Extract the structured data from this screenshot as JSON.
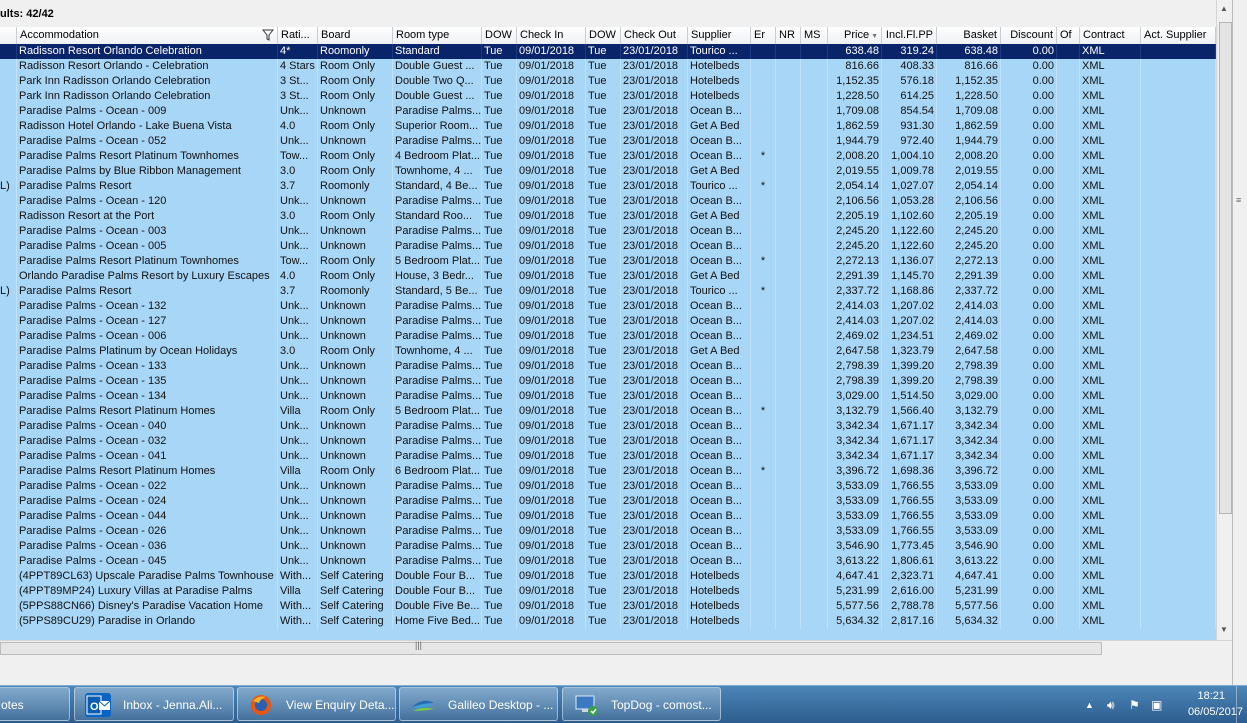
{
  "results": {
    "label": "ults: 42/42"
  },
  "columns": [
    {
      "label": "Accommodation",
      "align": "l"
    },
    {
      "label": "Rati...",
      "align": "l"
    },
    {
      "label": "Board",
      "align": "l"
    },
    {
      "label": "Room type",
      "align": "l"
    },
    {
      "label": "DOW",
      "align": "l"
    },
    {
      "label": "Check In",
      "align": "l"
    },
    {
      "label": "DOW",
      "align": "l"
    },
    {
      "label": "Check Out",
      "align": "l"
    },
    {
      "label": "Supplier",
      "align": "l"
    },
    {
      "label": "Er",
      "align": "l"
    },
    {
      "label": "NR",
      "align": "l"
    },
    {
      "label": "MS",
      "align": "l"
    },
    {
      "label": "Price",
      "align": "r"
    },
    {
      "label": "Incl.Fl.PP",
      "align": "r"
    },
    {
      "label": "Basket",
      "align": "r"
    },
    {
      "label": "Discount",
      "align": "r"
    },
    {
      "label": "Of",
      "align": "l"
    },
    {
      "label": "Contract",
      "align": "l"
    },
    {
      "label": "Act. Supplier",
      "align": "l"
    }
  ],
  "rows": [
    {
      "pre": "",
      "acc": "Radisson Resort Orlando Celebration",
      "rat": "4*",
      "board": "Roomonly",
      "room": "Standard",
      "dow1": "Tue",
      "in": "09/01/2018",
      "dow2": "Tue",
      "out": "23/01/2018",
      "sup": "Tourico ...",
      "er": "",
      "price": "638.48",
      "fl": "319.24",
      "bask": "638.48",
      "disc": "0.00",
      "con": "XML"
    },
    {
      "pre": "",
      "acc": "Radisson Resort Orlando - Celebration",
      "rat": "4 Stars",
      "board": "Room Only",
      "room": "Double Guest ...",
      "dow1": "Tue",
      "in": "09/01/2018",
      "dow2": "Tue",
      "out": "23/01/2018",
      "sup": "Hotelbeds",
      "er": "",
      "price": "816.66",
      "fl": "408.33",
      "bask": "816.66",
      "disc": "0.00",
      "con": "XML"
    },
    {
      "pre": "",
      "acc": "Park Inn Radisson Orlando Celebration",
      "rat": "3 St...",
      "board": "Room Only",
      "room": "Double Two Q...",
      "dow1": "Tue",
      "in": "09/01/2018",
      "dow2": "Tue",
      "out": "23/01/2018",
      "sup": "Hotelbeds",
      "er": "",
      "price": "1,152.35",
      "fl": "576.18",
      "bask": "1,152.35",
      "disc": "0.00",
      "con": "XML"
    },
    {
      "pre": "",
      "acc": "Park Inn Radisson Orlando Celebration",
      "rat": "3 St...",
      "board": "Room Only",
      "room": "Double Guest ...",
      "dow1": "Tue",
      "in": "09/01/2018",
      "dow2": "Tue",
      "out": "23/01/2018",
      "sup": "Hotelbeds",
      "er": "",
      "price": "1,228.50",
      "fl": "614.25",
      "bask": "1,228.50",
      "disc": "0.00",
      "con": "XML"
    },
    {
      "pre": "",
      "acc": "Paradise Palms - Ocean - 009",
      "rat": "Unk...",
      "board": "Unknown",
      "room": "Paradise Palms...",
      "dow1": "Tue",
      "in": "09/01/2018",
      "dow2": "Tue",
      "out": "23/01/2018",
      "sup": "Ocean B...",
      "er": "",
      "price": "1,709.08",
      "fl": "854.54",
      "bask": "1,709.08",
      "disc": "0.00",
      "con": "XML"
    },
    {
      "pre": "",
      "acc": "Radisson Hotel Orlando - Lake Buena Vista",
      "rat": "4.0",
      "board": "Room Only",
      "room": "Superior Room...",
      "dow1": "Tue",
      "in": "09/01/2018",
      "dow2": "Tue",
      "out": "23/01/2018",
      "sup": "Get A Bed",
      "er": "",
      "price": "1,862.59",
      "fl": "931.30",
      "bask": "1,862.59",
      "disc": "0.00",
      "con": "XML"
    },
    {
      "pre": "",
      "acc": "Paradise Palms - Ocean - 052",
      "rat": "Unk...",
      "board": "Unknown",
      "room": "Paradise Palms...",
      "dow1": "Tue",
      "in": "09/01/2018",
      "dow2": "Tue",
      "out": "23/01/2018",
      "sup": "Ocean B...",
      "er": "",
      "price": "1,944.79",
      "fl": "972.40",
      "bask": "1,944.79",
      "disc": "0.00",
      "con": "XML"
    },
    {
      "pre": "",
      "acc": "Paradise Palms Resort Platinum Townhomes",
      "rat": "Tow...",
      "board": "Room Only",
      "room": "4 Bedroom Plat...",
      "dow1": "Tue",
      "in": "09/01/2018",
      "dow2": "Tue",
      "out": "23/01/2018",
      "sup": "Ocean B...",
      "er": "*",
      "price": "2,008.20",
      "fl": "1,004.10",
      "bask": "2,008.20",
      "disc": "0.00",
      "con": "XML"
    },
    {
      "pre": "",
      "acc": "Paradise Palms by Blue Ribbon Management",
      "rat": "3.0",
      "board": "Room Only",
      "room": "Townhome, 4 ...",
      "dow1": "Tue",
      "in": "09/01/2018",
      "dow2": "Tue",
      "out": "23/01/2018",
      "sup": "Get A Bed",
      "er": "",
      "price": "2,019.55",
      "fl": "1,009.78",
      "bask": "2,019.55",
      "disc": "0.00",
      "con": "XML"
    },
    {
      "pre": "L)",
      "acc": "Paradise Palms Resort",
      "rat": "3.7",
      "board": "Roomonly",
      "room": "Standard, 4 Be...",
      "dow1": "Tue",
      "in": "09/01/2018",
      "dow2": "Tue",
      "out": "23/01/2018",
      "sup": "Tourico ...",
      "er": "*",
      "price": "2,054.14",
      "fl": "1,027.07",
      "bask": "2,054.14",
      "disc": "0.00",
      "con": "XML"
    },
    {
      "pre": "",
      "acc": "Paradise Palms - Ocean - 120",
      "rat": "Unk...",
      "board": "Unknown",
      "room": "Paradise Palms...",
      "dow1": "Tue",
      "in": "09/01/2018",
      "dow2": "Tue",
      "out": "23/01/2018",
      "sup": "Ocean B...",
      "er": "",
      "price": "2,106.56",
      "fl": "1,053.28",
      "bask": "2,106.56",
      "disc": "0.00",
      "con": "XML"
    },
    {
      "pre": "",
      "acc": "Radisson Resort at the Port",
      "rat": "3.0",
      "board": "Room Only",
      "room": "Standard Roo...",
      "dow1": "Tue",
      "in": "09/01/2018",
      "dow2": "Tue",
      "out": "23/01/2018",
      "sup": "Get A Bed",
      "er": "",
      "price": "2,205.19",
      "fl": "1,102.60",
      "bask": "2,205.19",
      "disc": "0.00",
      "con": "XML"
    },
    {
      "pre": "",
      "acc": "Paradise Palms - Ocean - 003",
      "rat": "Unk...",
      "board": "Unknown",
      "room": "Paradise Palms...",
      "dow1": "Tue",
      "in": "09/01/2018",
      "dow2": "Tue",
      "out": "23/01/2018",
      "sup": "Ocean B...",
      "er": "",
      "price": "2,245.20",
      "fl": "1,122.60",
      "bask": "2,245.20",
      "disc": "0.00",
      "con": "XML"
    },
    {
      "pre": "",
      "acc": "Paradise Palms - Ocean - 005",
      "rat": "Unk...",
      "board": "Unknown",
      "room": "Paradise Palms...",
      "dow1": "Tue",
      "in": "09/01/2018",
      "dow2": "Tue",
      "out": "23/01/2018",
      "sup": "Ocean B...",
      "er": "",
      "price": "2,245.20",
      "fl": "1,122.60",
      "bask": "2,245.20",
      "disc": "0.00",
      "con": "XML"
    },
    {
      "pre": "",
      "acc": "Paradise Palms Resort Platinum Townhomes",
      "rat": "Tow...",
      "board": "Room Only",
      "room": "5 Bedroom Plat...",
      "dow1": "Tue",
      "in": "09/01/2018",
      "dow2": "Tue",
      "out": "23/01/2018",
      "sup": "Ocean B...",
      "er": "*",
      "price": "2,272.13",
      "fl": "1,136.07",
      "bask": "2,272.13",
      "disc": "0.00",
      "con": "XML"
    },
    {
      "pre": "",
      "acc": "Orlando Paradise Palms Resort by Luxury Escapes",
      "rat": "4.0",
      "board": "Room Only",
      "room": "House, 3 Bedr...",
      "dow1": "Tue",
      "in": "09/01/2018",
      "dow2": "Tue",
      "out": "23/01/2018",
      "sup": "Get A Bed",
      "er": "",
      "price": "2,291.39",
      "fl": "1,145.70",
      "bask": "2,291.39",
      "disc": "0.00",
      "con": "XML"
    },
    {
      "pre": "L)",
      "acc": "Paradise Palms Resort",
      "rat": "3.7",
      "board": "Roomonly",
      "room": "Standard, 5 Be...",
      "dow1": "Tue",
      "in": "09/01/2018",
      "dow2": "Tue",
      "out": "23/01/2018",
      "sup": "Tourico ...",
      "er": "*",
      "price": "2,337.72",
      "fl": "1,168.86",
      "bask": "2,337.72",
      "disc": "0.00",
      "con": "XML"
    },
    {
      "pre": "",
      "acc": "Paradise Palms - Ocean - 132",
      "rat": "Unk...",
      "board": "Unknown",
      "room": "Paradise Palms...",
      "dow1": "Tue",
      "in": "09/01/2018",
      "dow2": "Tue",
      "out": "23/01/2018",
      "sup": "Ocean B...",
      "er": "",
      "price": "2,414.03",
      "fl": "1,207.02",
      "bask": "2,414.03",
      "disc": "0.00",
      "con": "XML"
    },
    {
      "pre": "",
      "acc": "Paradise Palms - Ocean - 127",
      "rat": "Unk...",
      "board": "Unknown",
      "room": "Paradise Palms...",
      "dow1": "Tue",
      "in": "09/01/2018",
      "dow2": "Tue",
      "out": "23/01/2018",
      "sup": "Ocean B...",
      "er": "",
      "price": "2,414.03",
      "fl": "1,207.02",
      "bask": "2,414.03",
      "disc": "0.00",
      "con": "XML"
    },
    {
      "pre": "",
      "acc": "Paradise Palms - Ocean - 006",
      "rat": "Unk...",
      "board": "Unknown",
      "room": "Paradise Palms...",
      "dow1": "Tue",
      "in": "09/01/2018",
      "dow2": "Tue",
      "out": "23/01/2018",
      "sup": "Ocean B...",
      "er": "",
      "price": "2,469.02",
      "fl": "1,234.51",
      "bask": "2,469.02",
      "disc": "0.00",
      "con": "XML"
    },
    {
      "pre": "",
      "acc": "Paradise Palms Platinum by Ocean Holidays",
      "rat": "3.0",
      "board": "Room Only",
      "room": "Townhome, 4 ...",
      "dow1": "Tue",
      "in": "09/01/2018",
      "dow2": "Tue",
      "out": "23/01/2018",
      "sup": "Get A Bed",
      "er": "",
      "price": "2,647.58",
      "fl": "1,323.79",
      "bask": "2,647.58",
      "disc": "0.00",
      "con": "XML"
    },
    {
      "pre": "",
      "acc": "Paradise Palms - Ocean - 133",
      "rat": "Unk...",
      "board": "Unknown",
      "room": "Paradise Palms...",
      "dow1": "Tue",
      "in": "09/01/2018",
      "dow2": "Tue",
      "out": "23/01/2018",
      "sup": "Ocean B...",
      "er": "",
      "price": "2,798.39",
      "fl": "1,399.20",
      "bask": "2,798.39",
      "disc": "0.00",
      "con": "XML"
    },
    {
      "pre": "",
      "acc": "Paradise Palms - Ocean - 135",
      "rat": "Unk...",
      "board": "Unknown",
      "room": "Paradise Palms...",
      "dow1": "Tue",
      "in": "09/01/2018",
      "dow2": "Tue",
      "out": "23/01/2018",
      "sup": "Ocean B...",
      "er": "",
      "price": "2,798.39",
      "fl": "1,399.20",
      "bask": "2,798.39",
      "disc": "0.00",
      "con": "XML"
    },
    {
      "pre": "",
      "acc": "Paradise Palms - Ocean - 134",
      "rat": "Unk...",
      "board": "Unknown",
      "room": "Paradise Palms...",
      "dow1": "Tue",
      "in": "09/01/2018",
      "dow2": "Tue",
      "out": "23/01/2018",
      "sup": "Ocean B...",
      "er": "",
      "price": "3,029.00",
      "fl": "1,514.50",
      "bask": "3,029.00",
      "disc": "0.00",
      "con": "XML"
    },
    {
      "pre": "",
      "acc": "Paradise Palms Resort Platinum Homes",
      "rat": "Villa",
      "board": "Room Only",
      "room": "5 Bedroom Plat...",
      "dow1": "Tue",
      "in": "09/01/2018",
      "dow2": "Tue",
      "out": "23/01/2018",
      "sup": "Ocean B...",
      "er": "*",
      "price": "3,132.79",
      "fl": "1,566.40",
      "bask": "3,132.79",
      "disc": "0.00",
      "con": "XML"
    },
    {
      "pre": "",
      "acc": "Paradise Palms - Ocean - 040",
      "rat": "Unk...",
      "board": "Unknown",
      "room": "Paradise Palms...",
      "dow1": "Tue",
      "in": "09/01/2018",
      "dow2": "Tue",
      "out": "23/01/2018",
      "sup": "Ocean B...",
      "er": "",
      "price": "3,342.34",
      "fl": "1,671.17",
      "bask": "3,342.34",
      "disc": "0.00",
      "con": "XML"
    },
    {
      "pre": "",
      "acc": "Paradise Palms - Ocean - 032",
      "rat": "Unk...",
      "board": "Unknown",
      "room": "Paradise Palms...",
      "dow1": "Tue",
      "in": "09/01/2018",
      "dow2": "Tue",
      "out": "23/01/2018",
      "sup": "Ocean B...",
      "er": "",
      "price": "3,342.34",
      "fl": "1,671.17",
      "bask": "3,342.34",
      "disc": "0.00",
      "con": "XML"
    },
    {
      "pre": "",
      "acc": "Paradise Palms - Ocean - 041",
      "rat": "Unk...",
      "board": "Unknown",
      "room": "Paradise Palms...",
      "dow1": "Tue",
      "in": "09/01/2018",
      "dow2": "Tue",
      "out": "23/01/2018",
      "sup": "Ocean B...",
      "er": "",
      "price": "3,342.34",
      "fl": "1,671.17",
      "bask": "3,342.34",
      "disc": "0.00",
      "con": "XML"
    },
    {
      "pre": "",
      "acc": "Paradise Palms Resort Platinum Homes",
      "rat": "Villa",
      "board": "Room Only",
      "room": "6 Bedroom Plat...",
      "dow1": "Tue",
      "in": "09/01/2018",
      "dow2": "Tue",
      "out": "23/01/2018",
      "sup": "Ocean B...",
      "er": "*",
      "price": "3,396.72",
      "fl": "1,698.36",
      "bask": "3,396.72",
      "disc": "0.00",
      "con": "XML"
    },
    {
      "pre": "",
      "acc": "Paradise Palms - Ocean - 022",
      "rat": "Unk...",
      "board": "Unknown",
      "room": "Paradise Palms...",
      "dow1": "Tue",
      "in": "09/01/2018",
      "dow2": "Tue",
      "out": "23/01/2018",
      "sup": "Ocean B...",
      "er": "",
      "price": "3,533.09",
      "fl": "1,766.55",
      "bask": "3,533.09",
      "disc": "0.00",
      "con": "XML"
    },
    {
      "pre": "",
      "acc": "Paradise Palms - Ocean - 024",
      "rat": "Unk...",
      "board": "Unknown",
      "room": "Paradise Palms...",
      "dow1": "Tue",
      "in": "09/01/2018",
      "dow2": "Tue",
      "out": "23/01/2018",
      "sup": "Ocean B...",
      "er": "",
      "price": "3,533.09",
      "fl": "1,766.55",
      "bask": "3,533.09",
      "disc": "0.00",
      "con": "XML"
    },
    {
      "pre": "",
      "acc": "Paradise Palms - Ocean - 044",
      "rat": "Unk...",
      "board": "Unknown",
      "room": "Paradise Palms...",
      "dow1": "Tue",
      "in": "09/01/2018",
      "dow2": "Tue",
      "out": "23/01/2018",
      "sup": "Ocean B...",
      "er": "",
      "price": "3,533.09",
      "fl": "1,766.55",
      "bask": "3,533.09",
      "disc": "0.00",
      "con": "XML"
    },
    {
      "pre": "",
      "acc": "Paradise Palms - Ocean - 026",
      "rat": "Unk...",
      "board": "Unknown",
      "room": "Paradise Palms...",
      "dow1": "Tue",
      "in": "09/01/2018",
      "dow2": "Tue",
      "out": "23/01/2018",
      "sup": "Ocean B...",
      "er": "",
      "price": "3,533.09",
      "fl": "1,766.55",
      "bask": "3,533.09",
      "disc": "0.00",
      "con": "XML"
    },
    {
      "pre": "",
      "acc": "Paradise Palms - Ocean - 036",
      "rat": "Unk...",
      "board": "Unknown",
      "room": "Paradise Palms...",
      "dow1": "Tue",
      "in": "09/01/2018",
      "dow2": "Tue",
      "out": "23/01/2018",
      "sup": "Ocean B...",
      "er": "",
      "price": "3,546.90",
      "fl": "1,773.45",
      "bask": "3,546.90",
      "disc": "0.00",
      "con": "XML"
    },
    {
      "pre": "",
      "acc": "Paradise Palms - Ocean - 045",
      "rat": "Unk...",
      "board": "Unknown",
      "room": "Paradise Palms...",
      "dow1": "Tue",
      "in": "09/01/2018",
      "dow2": "Tue",
      "out": "23/01/2018",
      "sup": "Ocean B...",
      "er": "",
      "price": "3,613.22",
      "fl": "1,806.61",
      "bask": "3,613.22",
      "disc": "0.00",
      "con": "XML"
    },
    {
      "pre": "",
      "acc": "(4PPT89CL63) Upscale Paradise Palms Townhouse",
      "rat": "With...",
      "board": "Self Catering",
      "room": "Double Four B...",
      "dow1": "Tue",
      "in": "09/01/2018",
      "dow2": "Tue",
      "out": "23/01/2018",
      "sup": "Hotelbeds",
      "er": "",
      "price": "4,647.41",
      "fl": "2,323.71",
      "bask": "4,647.41",
      "disc": "0.00",
      "con": "XML"
    },
    {
      "pre": "",
      "acc": "(4PPT89MP24) Luxury Villas at Paradise Palms",
      "rat": "Villa",
      "board": "Self Catering",
      "room": "Double Four B...",
      "dow1": "Tue",
      "in": "09/01/2018",
      "dow2": "Tue",
      "out": "23/01/2018",
      "sup": "Hotelbeds",
      "er": "",
      "price": "5,231.99",
      "fl": "2,616.00",
      "bask": "5,231.99",
      "disc": "0.00",
      "con": "XML"
    },
    {
      "pre": "",
      "acc": "(5PPS88CN66) Disney's Paradise Vacation Home",
      "rat": "With...",
      "board": "Self Catering",
      "room": "Double Five Be...",
      "dow1": "Tue",
      "in": "09/01/2018",
      "dow2": "Tue",
      "out": "23/01/2018",
      "sup": "Hotelbeds",
      "er": "",
      "price": "5,577.56",
      "fl": "2,788.78",
      "bask": "5,577.56",
      "disc": "0.00",
      "con": "XML"
    },
    {
      "pre": "",
      "acc": "(5PPS89CU29) Paradise in Orlando",
      "rat": "With...",
      "board": "Self Catering",
      "room": "Home Five Bed...",
      "dow1": "Tue",
      "in": "09/01/2018",
      "dow2": "Tue",
      "out": "23/01/2018",
      "sup": "Hotelbeds",
      "er": "",
      "price": "5,634.32",
      "fl": "2,817.16",
      "bask": "5,634.32",
      "disc": "0.00",
      "con": "XML"
    }
  ],
  "taskbar": {
    "buttons": [
      {
        "label": "otes",
        "icon": "notes-icon"
      },
      {
        "label": "Inbox - Jenna.Ali...",
        "icon": "outlook-icon"
      },
      {
        "label": "View Enquiry Deta...",
        "icon": "firefox-icon"
      },
      {
        "label": "Galileo Desktop - ...",
        "icon": "galileo-icon"
      },
      {
        "label": "TopDog - comost...",
        "icon": "topdog-icon"
      }
    ],
    "time": "18:21",
    "date": "06/05/2017"
  },
  "colors": {
    "grid_bg": "#a8d6f7",
    "selected_row": "#0a246a",
    "taskbar": "#3a6ea5"
  }
}
